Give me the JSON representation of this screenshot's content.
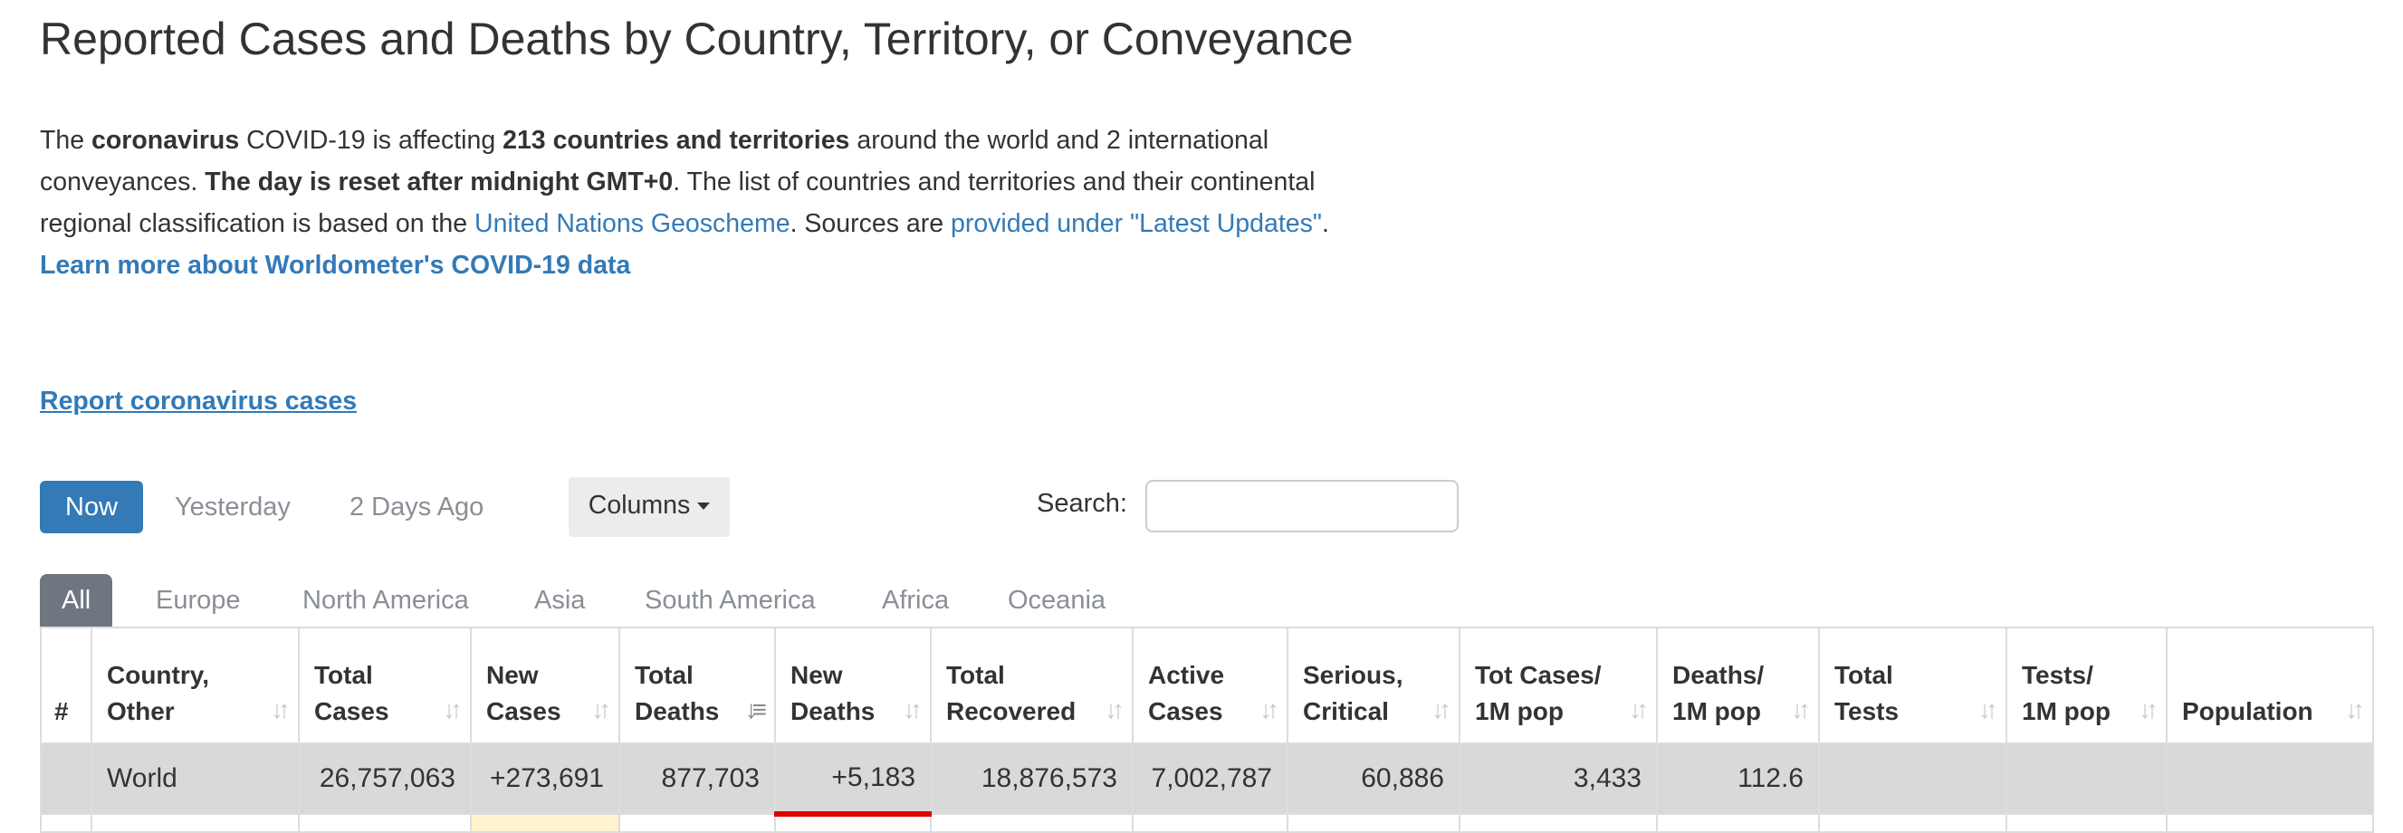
{
  "page": {
    "title": "Reported Cases and Deaths by Country, Territory, or Conveyance"
  },
  "intro": {
    "p1": "The ",
    "coronavirus": "coronavirus",
    "p2": " COVID-19 is affecting ",
    "countries": "213 countries and territories",
    "p3": " around the world and 2 international conveyances. ",
    "reset": "The day is reset after midnight GMT+0",
    "p4": ". The list of countries and territories and their continental regional classification is based on the ",
    "un_link": "United Nations Geoscheme",
    "p5": ". Sources are ",
    "sources_link": "provided under \"Latest Updates\"",
    "p6": ".",
    "learn_more": "Learn more about Worldometer's COVID-19 data"
  },
  "report_link": "Report coronavirus cases",
  "days": {
    "now": "Now",
    "yesterday": "Yesterday",
    "two_days": "2 Days Ago",
    "columns": "Columns"
  },
  "search": {
    "label": "Search:",
    "value": "",
    "placeholder": ""
  },
  "tabs": [
    "All",
    "Europe",
    "North America",
    "Asia",
    "South America",
    "Africa",
    "Oceania"
  ],
  "table": {
    "headers": [
      {
        "l1": "#",
        "l2": ""
      },
      {
        "l1": "Country,",
        "l2": "Other"
      },
      {
        "l1": "Total",
        "l2": "Cases"
      },
      {
        "l1": "New",
        "l2": "Cases"
      },
      {
        "l1": "Total",
        "l2": "Deaths"
      },
      {
        "l1": "New",
        "l2": "Deaths"
      },
      {
        "l1": "Total",
        "l2": "Recovered"
      },
      {
        "l1": "Active",
        "l2": "Cases"
      },
      {
        "l1": "Serious,",
        "l2": "Critical"
      },
      {
        "l1": "Tot Cases/",
        "l2": "1M pop"
      },
      {
        "l1": "Deaths/",
        "l2": "1M pop"
      },
      {
        "l1": "Total",
        "l2": "Tests"
      },
      {
        "l1": "Tests/",
        "l2": "1M pop"
      },
      {
        "l1": "",
        "l2": "Population"
      }
    ],
    "world_row": {
      "num": "",
      "country": "World",
      "total_cases": "26,757,063",
      "new_cases": "+273,691",
      "total_deaths": "877,703",
      "new_deaths": "+5,183",
      "total_recovered": "18,876,573",
      "active_cases": "7,002,787",
      "serious_critical": "60,886",
      "cases_per_1m": "3,433",
      "deaths_per_1m": "112.6",
      "total_tests": "",
      "tests_per_1m": "",
      "population": ""
    }
  },
  "colors": {
    "link": "#337ab7",
    "active_button": "#337ab7",
    "active_tab": "#6e7780",
    "world_row_bg": "#d9d9d9"
  }
}
